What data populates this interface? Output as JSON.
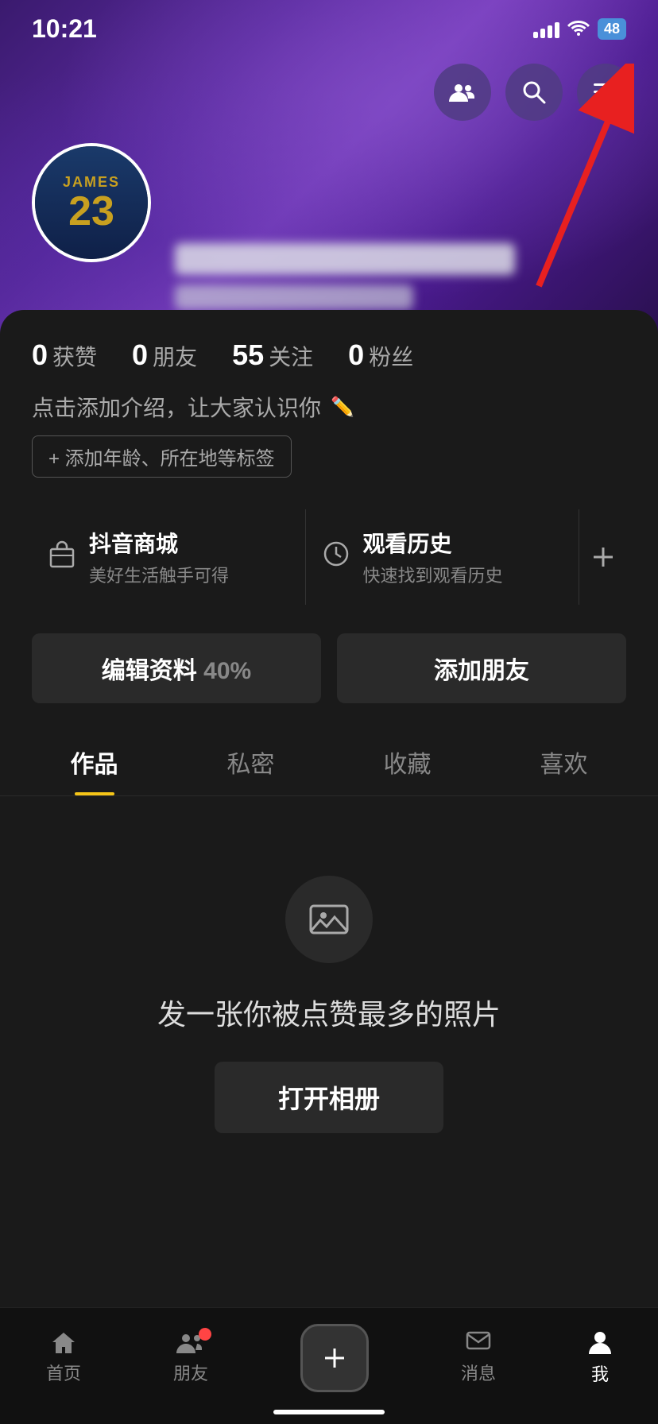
{
  "statusBar": {
    "time": "10:21",
    "battery": "48"
  },
  "topActions": {
    "friends_icon": "👥",
    "search_icon": "🔍",
    "menu_icon": "☰"
  },
  "avatar": {
    "jersey_name": "JAMES",
    "jersey_number": "23"
  },
  "stats": [
    {
      "number": "0",
      "label": "获赞"
    },
    {
      "number": "0",
      "label": "朋友"
    },
    {
      "number": "55",
      "label": "关注"
    },
    {
      "number": "0",
      "label": "粉丝"
    }
  ],
  "bio": {
    "placeholder": "点击添加介绍，让大家认识你",
    "tag_btn": "+ 添加年龄、所在地等标签"
  },
  "shortcuts": [
    {
      "icon": "🛒",
      "title": "抖音商城",
      "sub": "美好生活触手可得"
    },
    {
      "icon": "🕐",
      "title": "观看历史",
      "sub": "快速找到观看历史"
    }
  ],
  "shortcutExtra": "✳",
  "buttons": {
    "edit": "编辑资料",
    "edit_percent": "40%",
    "add_friend": "添加朋友"
  },
  "tabs": [
    {
      "label": "作品",
      "active": true
    },
    {
      "label": "私密",
      "active": false
    },
    {
      "label": "收藏",
      "active": false
    },
    {
      "label": "喜欢",
      "active": false
    }
  ],
  "emptyState": {
    "title": "发一张你被点赞最多的照片",
    "btn": "打开相册"
  },
  "bottomNav": [
    {
      "label": "首页",
      "active": false
    },
    {
      "label": "朋友",
      "active": false,
      "has_dot": true
    },
    {
      "label": "",
      "active": false,
      "is_add": true
    },
    {
      "label": "消息",
      "active": false
    },
    {
      "label": "我",
      "active": true
    }
  ]
}
